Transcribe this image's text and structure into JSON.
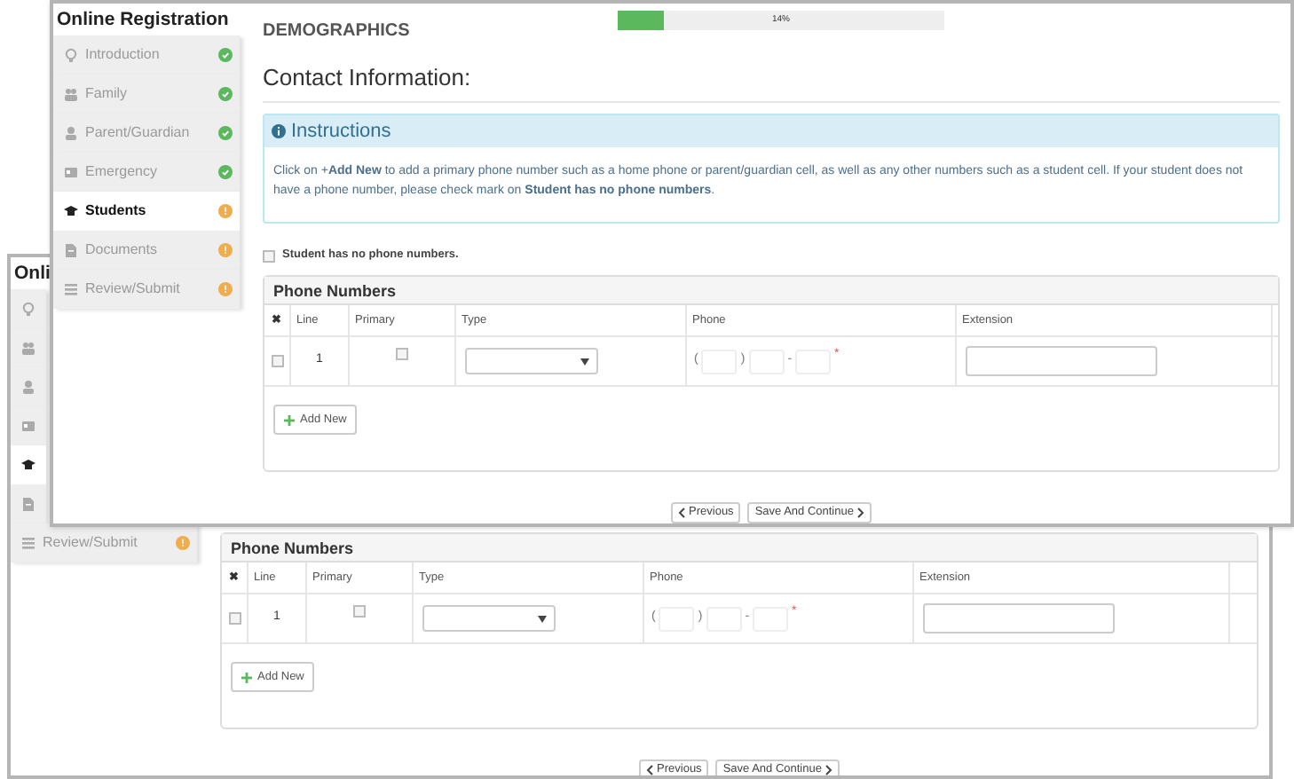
{
  "windows": [
    {
      "sidebar": {
        "title": "Onli",
        "items": [
          {
            "selected": false
          },
          {
            "selected": false
          },
          {
            "selected": false
          },
          {
            "selected": false
          },
          {
            "selected": true
          },
          {
            "selected": false
          },
          {
            "label": "Review/Submit",
            "done": false,
            "selected": false
          }
        ]
      },
      "main": {
        "phone_panel": {
          "title": "Phone Numbers",
          "columns": [
            "✖",
            "Line",
            "Primary",
            "Type",
            "Phone",
            "Extension"
          ],
          "rows": [
            {
              "checked": false,
              "line": "1",
              "primary": false,
              "phone": {
                "open": "(",
                "close": ")",
                "dash": "-",
                "required_mark": "*"
              }
            }
          ],
          "add_button": "Add New"
        },
        "nav": {
          "previous": "Previous",
          "next": "Save And Continue"
        }
      }
    },
    {
      "sidebar": {
        "title": "Online Registration",
        "items": [
          {
            "label": "Introduction",
            "done": true,
            "selected": false
          },
          {
            "label": "Family",
            "done": true,
            "selected": false
          },
          {
            "label": "Parent/Guardian",
            "done": true,
            "selected": false
          },
          {
            "label": "Emergency",
            "done": true,
            "selected": false
          },
          {
            "label": "Students",
            "done": false,
            "selected": true
          },
          {
            "label": "Documents",
            "done": false,
            "selected": false
          },
          {
            "label": "Review/Submit",
            "done": false,
            "selected": false
          }
        ]
      },
      "main": {
        "heading": "DEMOGRAPHICS",
        "progress": {
          "level": 0.14,
          "label": "14%"
        },
        "section_title": "Contact Information:",
        "instructions": {
          "title": "Instructions",
          "text": "Click on +**Add New** to add a primary phone number such as a home phone or parent/guardian cell, as well as any other numbers such as a student cell. If your student does not have a phone number, please check mark on **Student has no phone numbers**."
        },
        "no_phone": {
          "label": "Student has no phone numbers.",
          "checked": false
        },
        "phone_panel": {
          "title": "Phone Numbers",
          "columns": [
            "✖",
            "Line",
            "Primary",
            "Type",
            "Phone",
            "Extension"
          ],
          "rows": [
            {
              "checked": false,
              "line": "1",
              "primary": false,
              "phone": {
                "open": "(",
                "close": ")",
                "dash": "-",
                "required_mark": "*"
              }
            }
          ],
          "add_button": "Add New"
        },
        "nav": {
          "previous": "Previous",
          "next": "Save And Continue"
        }
      }
    }
  ]
}
